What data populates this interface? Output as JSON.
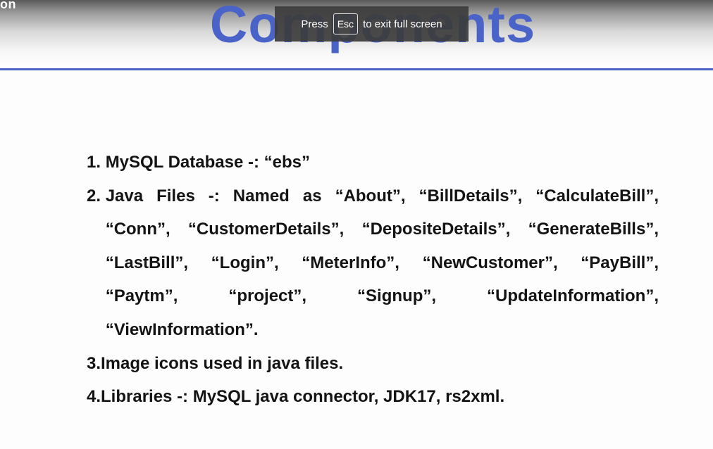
{
  "window": {
    "corner_text": "on"
  },
  "slide": {
    "title": "Components",
    "items": [
      {
        "number": "1. ",
        "text": "MySQL Database -: “ebs”"
      },
      {
        "number": "2. ",
        "text": "Java Files -: Named as “About”, “BillDetails”, “CalculateBill”, “Conn”, “CustomerDetails”, “DepositeDetails”, “GenerateBills”, “LastBill”, “Login”, “MeterInfo”, “NewCustomer”, “PayBill”, “Paytm”, “project”, “Signup”, “UpdateInformation”, “ViewInformation”."
      },
      {
        "number": "3.",
        "text": "Image icons used in java files."
      },
      {
        "number": "4.",
        "text": "Libraries -: MySQL java connector, JDK17, rs2xml."
      }
    ]
  },
  "fullscreen_notice": {
    "prefix": "Press",
    "key": "Esc",
    "suffix": "to exit full screen"
  }
}
